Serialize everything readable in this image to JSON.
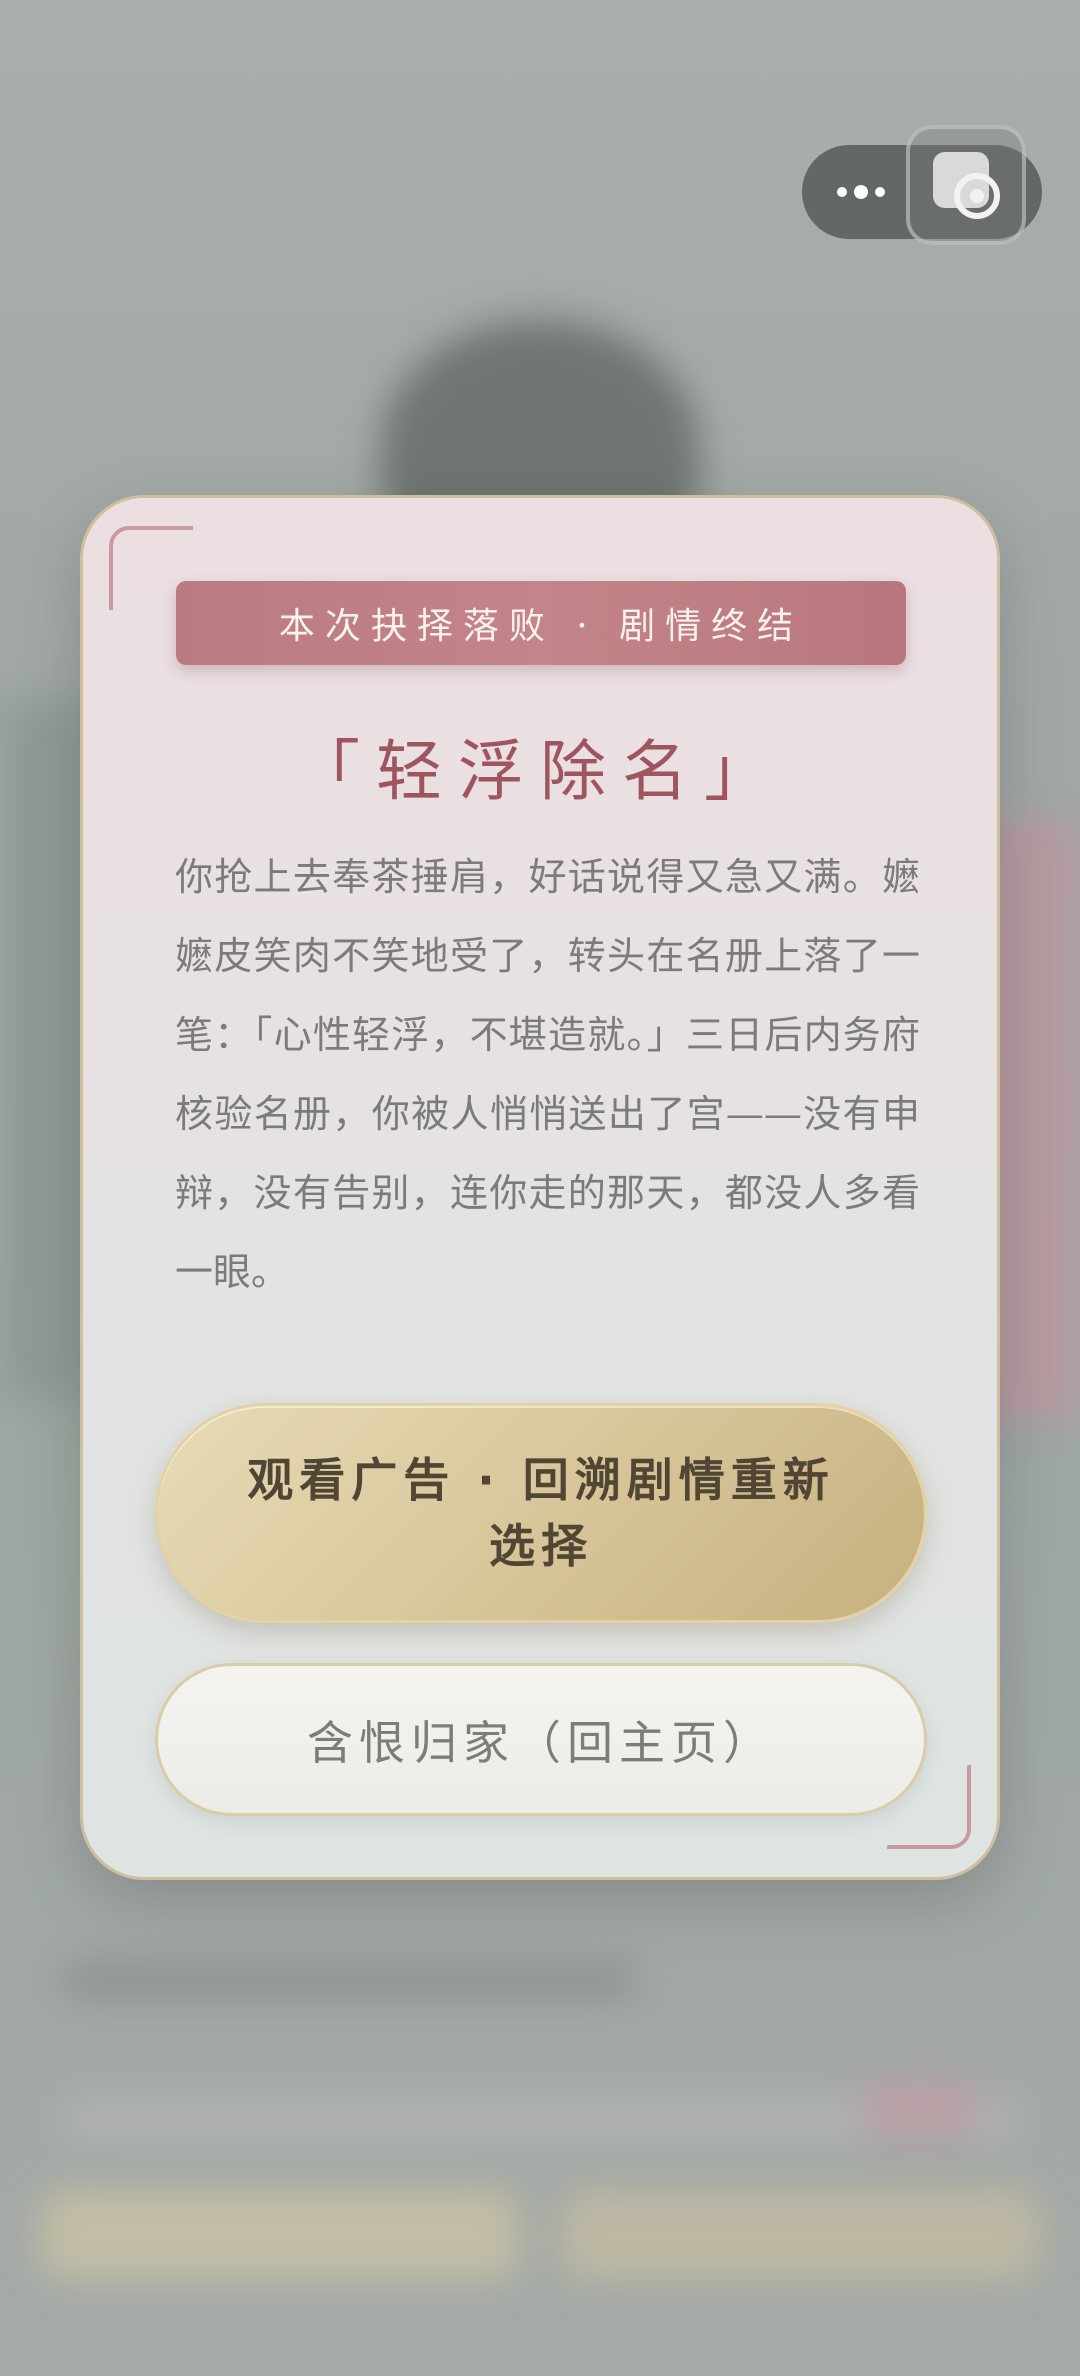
{
  "capsule": {
    "more_icon": "more-dots-icon",
    "close_icon": "close-target-icon"
  },
  "modal": {
    "banner": "本次抉择落败 · 剧情终结",
    "title": "「轻浮除名」",
    "story": "你抢上去奉茶捶肩，好话说得又急又满。嬷嬷皮笑肉不笑地受了，转头在名册上落了一笔：「心性轻浮，不堪造就。」三日后内务府核验名册，你被人悄悄送出了宫——没有申辩，没有告别，连你走的那天，都没人多看一眼。",
    "primary_button": "观看广告 · 回溯剧情重新选择",
    "secondary_button": "含恨归家（回主页）"
  },
  "colors": {
    "banner": "#c08186",
    "title": "#9e5560",
    "primary_button": "#d8c69b",
    "primary_text": "#514634",
    "secondary_text": "#7d7c79"
  }
}
